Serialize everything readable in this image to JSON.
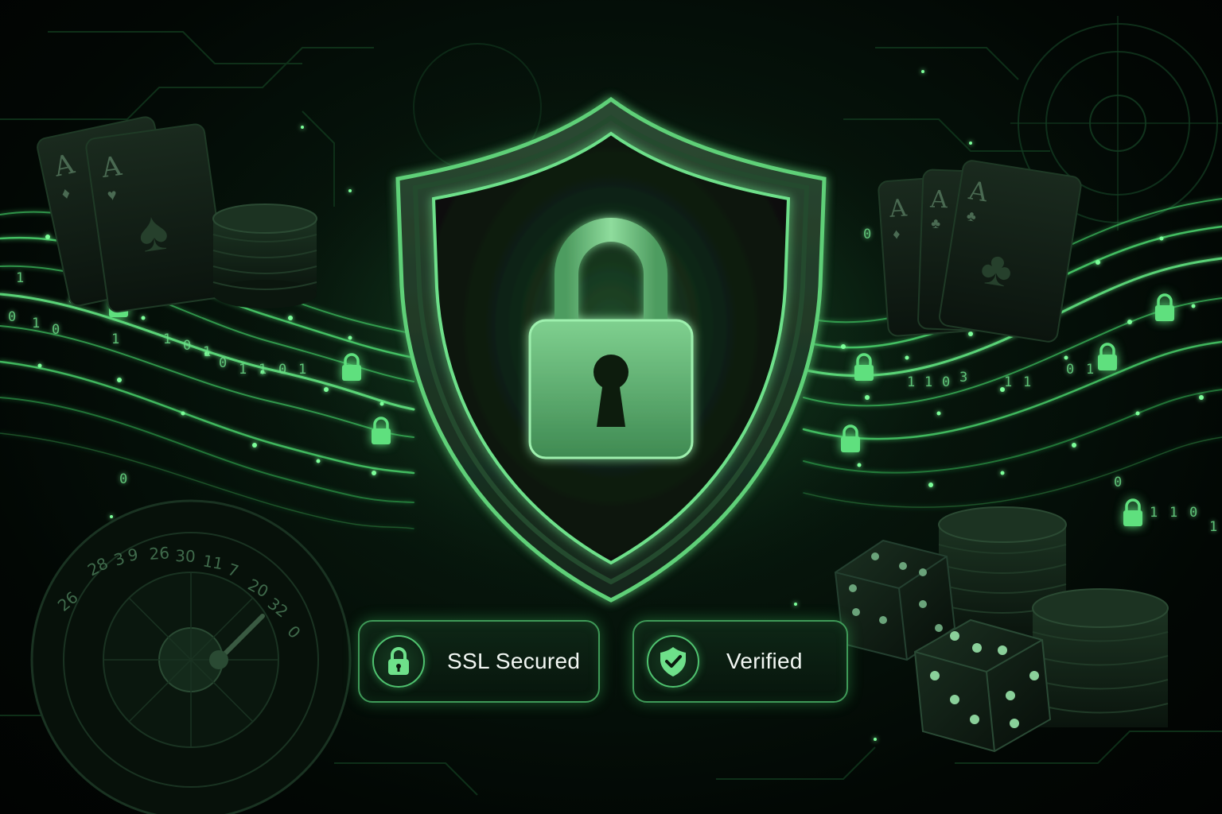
{
  "badges": {
    "ssl": {
      "label": "SSL Secured",
      "icon": "padlock-icon"
    },
    "verified": {
      "label": "Verified",
      "icon": "shield-check-icon"
    }
  },
  "card_ranks": {
    "left_back": "A",
    "left_front": "A",
    "right_back": "A",
    "right_middle": "A",
    "right_front": "A"
  },
  "roulette_numbers": [
    "26",
    "28",
    "3",
    "9",
    "26",
    "30",
    "11",
    "7",
    "20",
    "32",
    "0"
  ],
  "binary_left": [
    "1",
    "0",
    "1",
    "0",
    "1",
    "1",
    "0",
    "1",
    "0",
    "1",
    "1",
    "0",
    "1",
    "0"
  ],
  "binary_right": [
    "1",
    "1",
    "0",
    "3",
    "1",
    "1",
    "0",
    "1",
    "0",
    "1",
    "1",
    "0",
    "1",
    "0"
  ],
  "colors": {
    "accent": "#5fe07e",
    "accent_dark": "#2e7a43",
    "background": "#020604",
    "badge_text": "#f2f7f3"
  }
}
